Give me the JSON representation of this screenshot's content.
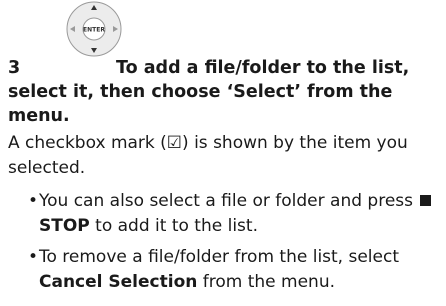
{
  "step": {
    "number": "3",
    "icon": "dpad-enter-icon",
    "enter_label": "ENTER",
    "heading": "To add a file/folder to the list, select it, then choose ‘Select’ from the menu.",
    "desc_before": "A checkbox mark (",
    "desc_checkbox": "☑",
    "desc_after": ") is shown by the item you selected."
  },
  "notes": [
    {
      "before": "You can also select a file or folder and press ",
      "stop_icon": "stop-icon",
      "bold": "STOP",
      "after": " to add it to the list."
    },
    {
      "before": "To remove a file/folder from the list, select ",
      "bold": "Cancel Selection",
      "after": " from the menu."
    }
  ]
}
